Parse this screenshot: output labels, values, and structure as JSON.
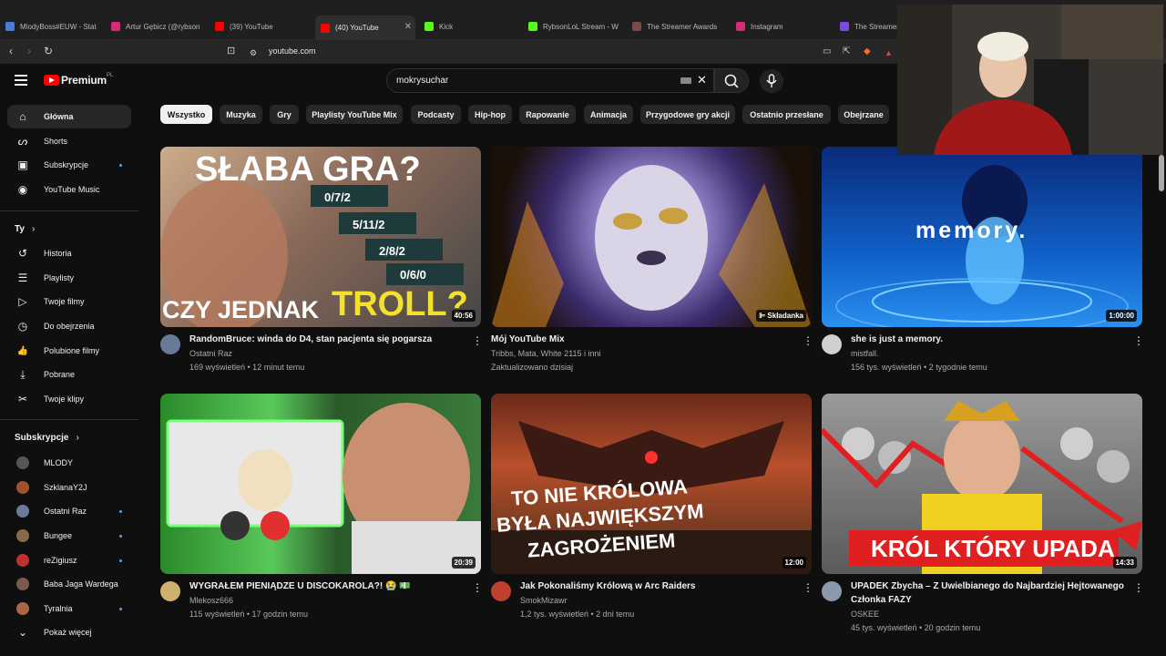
{
  "browser": {
    "tabs": [
      {
        "title": "MlodyBoss#EUW - Stat",
        "color": "#4a7bd6"
      },
      {
        "title": "Artur Gębicz (@rybson",
        "color": "#d62976"
      },
      {
        "title": "(39) YouTube",
        "color": "#ff0000"
      },
      {
        "title": "(40) YouTube",
        "color": "#ff0000"
      },
      {
        "title": "Kick",
        "color": "#53fc18"
      },
      {
        "title": "RybsonLoL Stream - W",
        "color": "#53fc18"
      },
      {
        "title": "The Streamer Awards",
        "color": "#7a4a4a"
      },
      {
        "title": "Instagram",
        "color": "#d62976"
      },
      {
        "title": "The Streamer",
        "color": "#7b4ae0"
      }
    ],
    "url": "youtube.com"
  },
  "header": {
    "logo_text": "Premium",
    "logo_region": "PL",
    "search_value": "mokrysuchar"
  },
  "sidebar": {
    "main": [
      {
        "label": "Główna",
        "icon": "home-icon",
        "glyph": "⌂"
      },
      {
        "label": "Shorts",
        "icon": "shorts-icon",
        "glyph": "ᔕ"
      },
      {
        "label": "Subskrypcje",
        "icon": "subscriptions-icon",
        "glyph": "▣"
      },
      {
        "label": "YouTube Music",
        "icon": "music-icon",
        "glyph": "◉"
      }
    ],
    "you_heading": "Ty",
    "you": [
      {
        "label": "Historia",
        "icon": "history-icon",
        "glyph": "↺"
      },
      {
        "label": "Playlisty",
        "icon": "playlists-icon",
        "glyph": "☰"
      },
      {
        "label": "Twoje filmy",
        "icon": "your-videos-icon",
        "glyph": "▷"
      },
      {
        "label": "Do obejrzenia",
        "icon": "watch-later-icon",
        "glyph": "◷"
      },
      {
        "label": "Polubione filmy",
        "icon": "liked-icon",
        "glyph": "👍"
      },
      {
        "label": "Pobrane",
        "icon": "download-icon",
        "glyph": "⤓"
      },
      {
        "label": "Twoje klipy",
        "icon": "clips-icon",
        "glyph": "✂"
      }
    ],
    "subs_heading": "Subskrypcje",
    "subs": [
      {
        "label": "MLODY",
        "color": "#555"
      },
      {
        "label": "SzklanaY2J",
        "color": "#a0522d"
      },
      {
        "label": "Ostatni Raz",
        "color": "#6a7b9a"
      },
      {
        "label": "Bungee",
        "color": "#8a6a4a"
      },
      {
        "label": "reZigiusz",
        "color": "#c03030"
      },
      {
        "label": "Baba Jaga Wardega",
        "color": "#7a5a4a"
      },
      {
        "label": "Tyralnia",
        "color": "#aa6644"
      }
    ],
    "show_more": "Pokaż więcej"
  },
  "chips": [
    "Wszystko",
    "Muzyka",
    "Gry",
    "Playlisty YouTube Mix",
    "Podcasty",
    "Hip-hop",
    "Rapowanie",
    "Animacja",
    "Przygodowe gry akcji",
    "Ostatnio przesłane",
    "Obejrzane"
  ],
  "videos": [
    {
      "title": "RandomBruce: winda do D4, stan pacjenta się pogarsza",
      "title2": "",
      "channel": "Ostatni Raz",
      "stats": "169 wyświetleń • 12 minut temu",
      "duration": "40:56",
      "thumb_top": "SŁABA GRA?",
      "thumb_bottom_a": "CZY JEDNAK",
      "thumb_bottom_b": "TROLL?",
      "kdas": [
        "0/7/2",
        "5/11/2",
        "2/8/2",
        "0/6/0"
      ]
    },
    {
      "title": "Mój YouTube Mix",
      "title2": "",
      "channel": "Tribbs, Mata, White 2115 i inni",
      "stats": "Zaktualizowano dzisiaj",
      "duration": "Składanka"
    },
    {
      "title": "she is just a memory.",
      "title2": "",
      "channel": "mistfall.",
      "stats": "156 tys. wyświetleń • 2 tygodnie temu",
      "duration": "1:00:00",
      "thumb_text": "memory."
    },
    {
      "title": "WYGRAŁEM PIENIĄDZE U DISCOKAROLA?! 😭 💵",
      "title2": "",
      "channel": "Mlekosz666",
      "stats": "115 wyświetleń • 17 godzin temu",
      "duration": "20:39"
    },
    {
      "title": "Jak Pokonaliśmy Królową w Arc Raiders",
      "title2": "",
      "channel": "SmokMizawr",
      "stats": "1,2 tys. wyświetleń • 2 dni temu",
      "duration": "12:00",
      "thumb_text_lines": [
        "TO NIE KRÓLOWA",
        "BYŁA NAJWIĘKSZYM",
        "ZAGROŻENIEM"
      ]
    },
    {
      "title": "UPADEK Zbycha – Z Uwielbianego do Najbardziej Hejtowanego",
      "title2": "Członka FAZY",
      "channel": "OSKEE",
      "stats": "45 tys. wyświetleń • 20 godzin temu",
      "duration": "14:33",
      "thumb_text": "KRÓL KTÓRY UPADA"
    }
  ],
  "colors": {
    "accent": "#ff0000",
    "background": "#0f0f0f",
    "dot": "#3ea6ff"
  }
}
